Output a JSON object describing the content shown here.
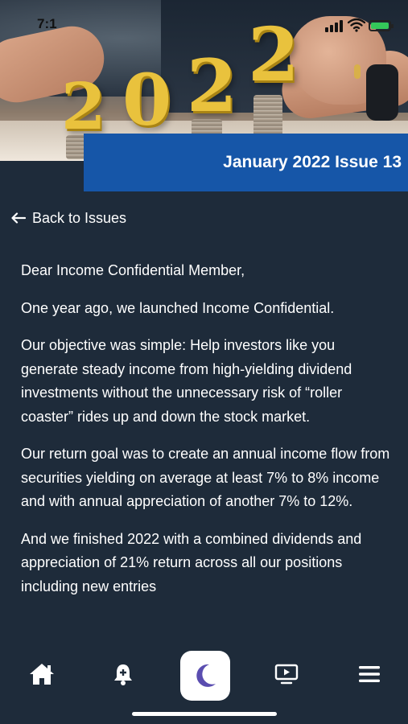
{
  "status_bar": {
    "time": "7:1"
  },
  "hero": {
    "digits": [
      "2",
      "0",
      "2",
      "2"
    ]
  },
  "issue": {
    "title": "January 2022 Issue 13"
  },
  "nav": {
    "back_label": "Back to Issues"
  },
  "article": {
    "paragraphs": [
      "Dear Income Confidential Member,",
      "One year ago, we launched Income Confidential.",
      "Our objective was simple: Help investors like you generate steady income from high-yielding dividend investments without the unnecessary risk of “roller coaster” rides up and down the stock market.",
      "Our return goal was to create an annual income flow from securities yielding on average at least 7% to 8% income and with annual appreciation of another 7% to 12%.",
      "And we finished 2022 with a combined dividends and appreciation of 21% return across all our positions including new entries"
    ]
  },
  "tab_bar": {
    "items": [
      "home-icon",
      "alert-bell-icon",
      "moon-icon",
      "video-icon",
      "menu-icon"
    ],
    "center_color": "#5a4db0"
  },
  "colors": {
    "background": "#1e2b3a",
    "banner": "#1656a8",
    "gold": "#e9c23d"
  }
}
